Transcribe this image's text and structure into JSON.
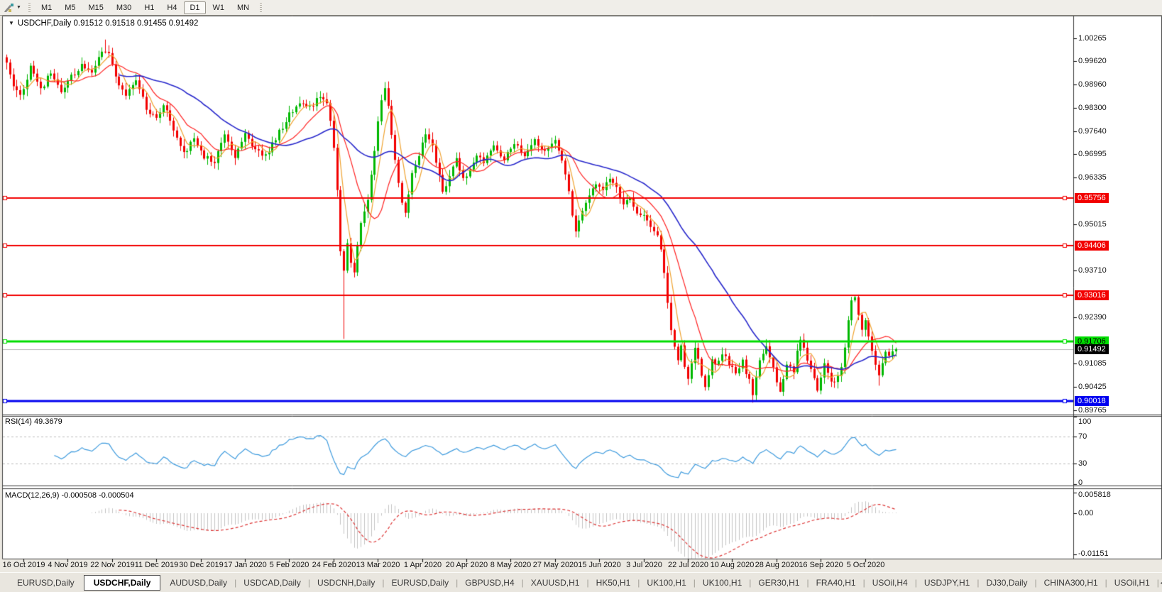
{
  "toolbar": {
    "tool_icon": "drawing-tools-icon",
    "caret_glyph": "▼",
    "timeframes": [
      "M1",
      "M5",
      "M15",
      "M30",
      "H1",
      "H4",
      "D1",
      "W1",
      "MN"
    ],
    "active_timeframe": "D1"
  },
  "chart": {
    "collapse_glyph": "▼",
    "title_text": "USDCHF,Daily  0.91512 0.91518 0.91455 0.91492",
    "symbol": "USDCHF",
    "timeframe": "Daily",
    "open": "0.91512",
    "high": "0.91518",
    "low": "0.91455",
    "close": "0.91492"
  },
  "price_axis": {
    "labels": [
      {
        "text": "1.00265",
        "value": 1.00265
      },
      {
        "text": "0.99620",
        "value": 0.9962
      },
      {
        "text": "0.98960",
        "value": 0.9896
      },
      {
        "text": "0.98300",
        "value": 0.983
      },
      {
        "text": "0.97640",
        "value": 0.9764
      },
      {
        "text": "0.96995",
        "value": 0.96995
      },
      {
        "text": "0.96335",
        "value": 0.96335
      },
      {
        "text": "0.95015",
        "value": 0.95015
      },
      {
        "text": "0.93710",
        "value": 0.9371
      },
      {
        "text": "0.92390",
        "value": 0.9239
      },
      {
        "text": "0.91085",
        "value": 0.91085
      },
      {
        "text": "0.90425",
        "value": 0.90425
      },
      {
        "text": "0.89765",
        "value": 0.89765
      }
    ],
    "badges": [
      {
        "text": "0.95756",
        "value": 0.95756,
        "bg": "#F20000",
        "fg": "#ffffff",
        "kind": "resistance-line"
      },
      {
        "text": "0.94406",
        "value": 0.94406,
        "bg": "#F20000",
        "fg": "#ffffff",
        "kind": "resistance-line"
      },
      {
        "text": "0.93016",
        "value": 0.93016,
        "bg": "#F20000",
        "fg": "#ffffff",
        "kind": "resistance-line"
      },
      {
        "text": "0.91706",
        "value": 0.91706,
        "bg": "#00DD00",
        "fg": "#000000",
        "kind": "support-line"
      },
      {
        "text": "0.91492",
        "value": 0.91492,
        "bg": "#000000",
        "fg": "#ffffff",
        "kind": "current-price"
      },
      {
        "text": "0.90018",
        "value": 0.90018,
        "bg": "#0000F0",
        "fg": "#ffffff",
        "kind": "support-line"
      }
    ]
  },
  "time_axis": {
    "dates": [
      "16 Oct 2019",
      "4 Nov 2019",
      "22 Nov 2019",
      "11 Dec 2019",
      "30 Dec 2019",
      "17 Jan 2020",
      "5 Feb 2020",
      "24 Feb 2020",
      "13 Mar 2020",
      "1 Apr 2020",
      "20 Apr 2020",
      "8 May 2020",
      "27 May 2020",
      "15 Jun 2020",
      "3 Jul 2020",
      "22 Jul 2020",
      "10 Aug 2020",
      "28 Aug 2020",
      "16 Sep 2020",
      "5 Oct 2020"
    ]
  },
  "indicators": {
    "rsi": {
      "label": "RSI(14) 49.3679",
      "period": 14,
      "value": 49.3679,
      "axis_labels": [
        {
          "text": "100",
          "value": 100
        },
        {
          "text": "70",
          "value": 70
        },
        {
          "text": "30",
          "value": 30
        },
        {
          "text": "0",
          "value": 0
        }
      ],
      "levels": [
        70,
        30
      ]
    },
    "macd": {
      "label": "MACD(12,26,9) -0.000508 -0.000504",
      "fast": 12,
      "slow": 26,
      "signal": 9,
      "macd_value": -0.000508,
      "signal_value": -0.000504,
      "axis_labels": [
        {
          "text": "0.005818",
          "value": 0.005818
        },
        {
          "text": "0.00",
          "value": 0
        },
        {
          "text": "-0.01151",
          "value": -0.01151
        }
      ]
    }
  },
  "tabs": {
    "scroll_left_glyph": "◄",
    "scroll_right_glyph": "►",
    "items": [
      {
        "label": "EURUSD,Daily",
        "active": false
      },
      {
        "label": "USDCHF,Daily",
        "active": true
      },
      {
        "label": "AUDUSD,Daily",
        "active": false
      },
      {
        "label": "USDCAD,Daily",
        "active": false
      },
      {
        "label": "USDCNH,Daily",
        "active": false
      },
      {
        "label": "EURUSD,Daily",
        "active": false
      },
      {
        "label": "GBPUSD,H4",
        "active": false
      },
      {
        "label": "XAUUSD,H1",
        "active": false
      },
      {
        "label": "HK50,H1",
        "active": false
      },
      {
        "label": "UK100,H1",
        "active": false
      },
      {
        "label": "UK100,H1",
        "active": false
      },
      {
        "label": "GER30,H1",
        "active": false
      },
      {
        "label": "FRA40,H1",
        "active": false
      },
      {
        "label": "USOil,H4",
        "active": false
      },
      {
        "label": "USDJPY,H1",
        "active": false
      },
      {
        "label": "DJ30,Daily",
        "active": false
      },
      {
        "label": "CHINA300,H1",
        "active": false
      },
      {
        "label": "USOil,H1",
        "active": false
      }
    ]
  },
  "chart_data": {
    "type": "candlestick",
    "symbol": "USDCHF",
    "timeframe": "Daily",
    "ohlc_current": {
      "open": 0.91512,
      "high": 0.91518,
      "low": 0.91455,
      "close": 0.91492
    },
    "y_axis": {
      "min": 0.89765,
      "max": 1.00265
    },
    "x_axis": {
      "tick_dates_every_candles": 13,
      "first_tick_candle": 5
    },
    "candle_count": 262,
    "candle_colors": {
      "bull": "#00B800",
      "bear": "#F20000"
    },
    "close_anchors": [
      [
        0,
        0.9958
      ],
      [
        2,
        0.9898
      ],
      [
        4,
        0.986
      ],
      [
        7,
        0.9946
      ],
      [
        10,
        0.9882
      ],
      [
        13,
        0.993
      ],
      [
        16,
        0.9872
      ],
      [
        19,
        0.9916
      ],
      [
        22,
        0.9948
      ],
      [
        25,
        0.9934
      ],
      [
        28,
        0.9996
      ],
      [
        30,
        0.9988
      ],
      [
        33,
        0.9892
      ],
      [
        35,
        0.9868
      ],
      [
        38,
        0.9912
      ],
      [
        41,
        0.983
      ],
      [
        44,
        0.9802
      ],
      [
        46,
        0.9844
      ],
      [
        49,
        0.9772
      ],
      [
        52,
        0.97
      ],
      [
        55,
        0.9746
      ],
      [
        58,
        0.9694
      ],
      [
        61,
        0.9682
      ],
      [
        64,
        0.9756
      ],
      [
        67,
        0.9696
      ],
      [
        70,
        0.9752
      ],
      [
        73,
        0.9712
      ],
      [
        76,
        0.9692
      ],
      [
        80,
        0.9762
      ],
      [
        83,
        0.981
      ],
      [
        86,
        0.9846
      ],
      [
        89,
        0.9832
      ],
      [
        92,
        0.986
      ],
      [
        94,
        0.9836
      ],
      [
        95,
        0.98
      ],
      [
        96,
        0.9718
      ],
      [
        97,
        0.9598
      ],
      [
        98,
        0.943
      ],
      [
        99,
        0.9365
      ],
      [
        100,
        0.9452
      ],
      [
        101,
        0.94
      ],
      [
        102,
        0.9368
      ],
      [
        103,
        0.9442
      ],
      [
        104,
        0.95
      ],
      [
        106,
        0.9575
      ],
      [
        108,
        0.9716
      ],
      [
        110,
        0.9858
      ],
      [
        111,
        0.9886
      ],
      [
        112,
        0.9838
      ],
      [
        114,
        0.968
      ],
      [
        116,
        0.9565
      ],
      [
        117,
        0.9532
      ],
      [
        119,
        0.9642
      ],
      [
        121,
        0.97
      ],
      [
        123,
        0.9762
      ],
      [
        125,
        0.9722
      ],
      [
        127,
        0.9642
      ],
      [
        128,
        0.9586
      ],
      [
        130,
        0.9642
      ],
      [
        132,
        0.9682
      ],
      [
        134,
        0.9626
      ],
      [
        136,
        0.9662
      ],
      [
        138,
        0.9702
      ],
      [
        140,
        0.968
      ],
      [
        143,
        0.972
      ],
      [
        146,
        0.969
      ],
      [
        149,
        0.973
      ],
      [
        152,
        0.97
      ],
      [
        155,
        0.974
      ],
      [
        158,
        0.971
      ],
      [
        161,
        0.9735
      ],
      [
        163,
        0.968
      ],
      [
        165,
        0.96
      ],
      [
        166,
        0.952
      ],
      [
        167,
        0.9478
      ],
      [
        169,
        0.954
      ],
      [
        171,
        0.959
      ],
      [
        173,
        0.962
      ],
      [
        175,
        0.96
      ],
      [
        177,
        0.963
      ],
      [
        179,
        0.96
      ],
      [
        181,
        0.956
      ],
      [
        183,
        0.957
      ],
      [
        185,
        0.954
      ],
      [
        187,
        0.9525
      ],
      [
        189,
        0.95
      ],
      [
        191,
        0.9468
      ],
      [
        192,
        0.943
      ],
      [
        193,
        0.936
      ],
      [
        194,
        0.928
      ],
      [
        195,
        0.92
      ],
      [
        196,
        0.915
      ],
      [
        197,
        0.9118
      ],
      [
        198,
        0.916
      ],
      [
        199,
        0.91
      ],
      [
        200,
        0.9065
      ],
      [
        201,
        0.9105
      ],
      [
        202,
        0.915
      ],
      [
        203,
        0.912
      ],
      [
        204,
        0.908
      ],
      [
        205,
        0.9045
      ],
      [
        206,
        0.908
      ],
      [
        207,
        0.9125
      ],
      [
        208,
        0.91
      ],
      [
        210,
        0.914
      ],
      [
        212,
        0.9105
      ],
      [
        214,
        0.9078
      ],
      [
        216,
        0.9112
      ],
      [
        218,
        0.906
      ],
      [
        219,
        0.902
      ],
      [
        220,
        0.9072
      ],
      [
        221,
        0.9122
      ],
      [
        223,
        0.915
      ],
      [
        225,
        0.91
      ],
      [
        226,
        0.906
      ],
      [
        227,
        0.9036
      ],
      [
        228,
        0.9072
      ],
      [
        229,
        0.9112
      ],
      [
        231,
        0.9092
      ],
      [
        232,
        0.914
      ],
      [
        233,
        0.9175
      ],
      [
        235,
        0.912
      ],
      [
        237,
        0.9065
      ],
      [
        238,
        0.904
      ],
      [
        239,
        0.9066
      ],
      [
        240,
        0.9106
      ],
      [
        241,
        0.9084
      ],
      [
        242,
        0.9064
      ],
      [
        243,
        0.9052
      ],
      [
        244,
        0.907
      ],
      [
        245,
        0.9096
      ],
      [
        246,
        0.9156
      ],
      [
        247,
        0.9226
      ],
      [
        248,
        0.9286
      ],
      [
        249,
        0.9294
      ],
      [
        250,
        0.9244
      ],
      [
        251,
        0.9206
      ],
      [
        252,
        0.923
      ],
      [
        253,
        0.9186
      ],
      [
        254,
        0.9146
      ],
      [
        255,
        0.9106
      ],
      [
        256,
        0.9078
      ],
      [
        257,
        0.9106
      ],
      [
        258,
        0.9144
      ],
      [
        259,
        0.9124
      ],
      [
        260,
        0.9138
      ],
      [
        261,
        0.91492
      ]
    ],
    "wick_overrides": {
      "29": {
        "high": 1.0023
      },
      "99": {
        "low": 0.9178
      },
      "111": {
        "high": 0.9903
      },
      "167": {
        "low": 0.9465
      },
      "200": {
        "low": 0.9048
      },
      "205": {
        "low": 0.9032
      },
      "219": {
        "low": 0.8998
      },
      "227": {
        "low": 0.9028
      },
      "249": {
        "high": 0.9302
      },
      "256": {
        "low": 0.9046
      }
    },
    "horizontal_lines": [
      {
        "price": 0.95756,
        "color": "#F20000",
        "width": 2,
        "kind": "resistance"
      },
      {
        "price": 0.94406,
        "color": "#F20000",
        "width": 2,
        "kind": "resistance"
      },
      {
        "price": 0.93016,
        "color": "#F20000",
        "width": 2,
        "kind": "resistance"
      },
      {
        "price": 0.91706,
        "color": "#00DD00",
        "width": 3,
        "kind": "support"
      },
      {
        "price": 0.91492,
        "color": "#B4B4B4",
        "width": 1,
        "kind": "current-price"
      },
      {
        "price": 0.90018,
        "color": "#0000F0",
        "width": 3,
        "kind": "support"
      }
    ],
    "moving_averages": [
      {
        "period": 5,
        "color": "#F0A22E"
      },
      {
        "period": 13,
        "color": "#FF2222"
      },
      {
        "period": 34,
        "color": "#2828CC"
      }
    ],
    "rsi": {
      "period": 14,
      "current": 49.3679,
      "overbought": 70,
      "oversold": 30,
      "color": "#3E9BDE",
      "level_color": "#BBBBBB"
    },
    "macd": {
      "fast": 12,
      "slow": 26,
      "signal_period": 9,
      "current_macd": -0.000508,
      "current_signal": -0.000504,
      "histogram_color": "#C4C4C4",
      "signal_color": "#DD3333",
      "scale_max": 0.005818,
      "scale_min": -0.01151
    }
  }
}
